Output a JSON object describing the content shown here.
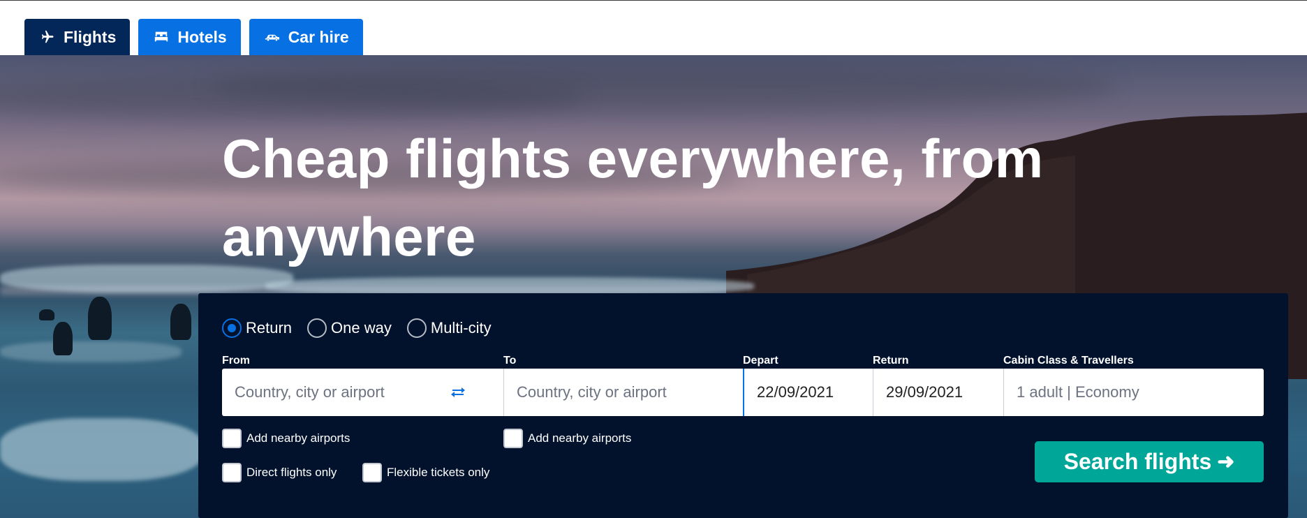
{
  "tabs": [
    {
      "label": "Flights",
      "icon": "airplane-icon",
      "active": true
    },
    {
      "label": "Hotels",
      "icon": "bed-icon",
      "active": false
    },
    {
      "label": "Car hire",
      "icon": "car-icon",
      "active": false
    }
  ],
  "hero": {
    "headline": "Cheap flights everywhere, from anywhere"
  },
  "search": {
    "trip_types": [
      {
        "label": "Return",
        "checked": true
      },
      {
        "label": "One way",
        "checked": false
      },
      {
        "label": "Multi-city",
        "checked": false
      }
    ],
    "from": {
      "label": "From",
      "placeholder": "Country, city or airport",
      "value": ""
    },
    "to": {
      "label": "To",
      "placeholder": "Country, city or airport",
      "value": ""
    },
    "depart": {
      "label": "Depart",
      "value": "22/09/2021"
    },
    "return": {
      "label": "Return",
      "value": "29/09/2021"
    },
    "cabin": {
      "label": "Cabin Class & Travellers",
      "value": "1 adult | Economy"
    },
    "options": {
      "nearby_from": "Add nearby airports",
      "nearby_to": "Add nearby airports",
      "direct": "Direct flights only",
      "flexible": "Flexible tickets only"
    },
    "submit_label": "Search flights",
    "submit_arrow": "➜"
  },
  "colors": {
    "brand_blue": "#0770e3",
    "active_tab": "#042759",
    "panel": "#02122c",
    "search_button": "#00a698"
  }
}
